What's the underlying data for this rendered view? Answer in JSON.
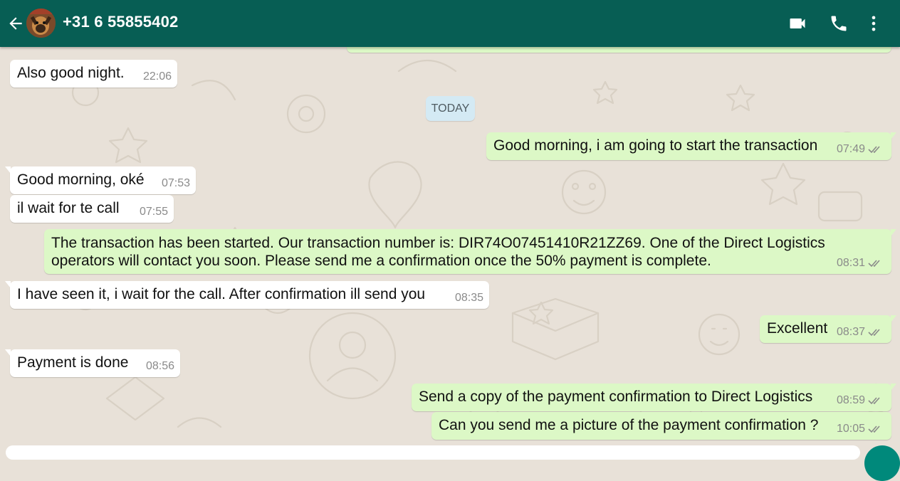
{
  "header": {
    "contact_name": "+31 6 55855402",
    "background_color": "#075e54",
    "icons": [
      "back-arrow-icon",
      "video-call-icon",
      "phone-icon",
      "more-options-icon"
    ]
  },
  "date_separator": "TODAY",
  "messages": [
    {
      "direction": "incoming",
      "text": "Also good night.",
      "time": "22:06"
    },
    {
      "direction": "outgoing",
      "text": "Good morning, i am going to start the transaction",
      "time": "07:49",
      "status": "read"
    },
    {
      "direction": "incoming",
      "text": "Good morning, oké",
      "time": "07:53"
    },
    {
      "direction": "incoming",
      "text": "il wait for te call",
      "time": "07:55"
    },
    {
      "direction": "outgoing",
      "text": "The transaction has been started. Our transaction number is: DIR74O07451410R21ZZ69. One of the Direct Logistics operators will contact you soon. Please send me a confirmation once the 50% payment is complete.",
      "time": "08:31",
      "status": "read"
    },
    {
      "direction": "incoming",
      "text": "I have seen it, i wait for the call. After confirmation ill send you",
      "time": "08:35"
    },
    {
      "direction": "outgoing",
      "text": "Excellent",
      "time": "08:37",
      "status": "read"
    },
    {
      "direction": "incoming",
      "text": "Payment is done",
      "time": "08:56"
    },
    {
      "direction": "outgoing",
      "text": "Send a copy of the payment confirmation to Direct Logistics",
      "time": "08:59",
      "status": "read"
    },
    {
      "direction": "outgoing",
      "text": "Can you send me a picture of the payment confirmation ?",
      "time": "10:05",
      "status": "read"
    }
  ],
  "colors": {
    "incoming_bubble": "#ffffff",
    "outgoing_bubble": "#dcf8c6",
    "chat_background": "#e8e1d8",
    "date_chip": "#d4eaf4"
  }
}
